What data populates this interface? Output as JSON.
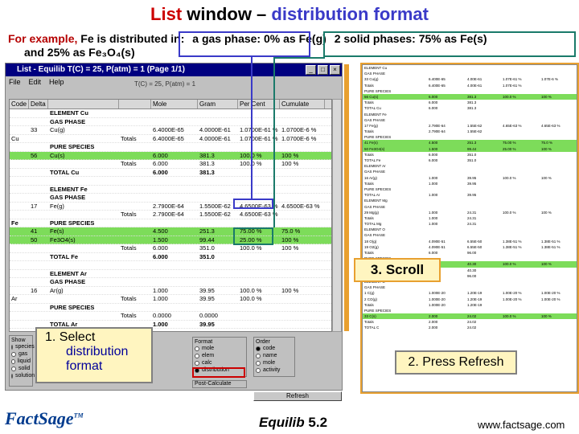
{
  "slide": {
    "title_part1": "List",
    "title_part2": "window –",
    "title_part3": "distribution format",
    "example_line1_red": "For example,",
    "example_line1_black": "Fe is distributed in:",
    "example_line1_gas": "a gas phase: 0% as Fe(g)",
    "example_line1_solid": "2 solid phases: 75% as Fe(s)",
    "example_line2": "and 25% as Fe₃O₄(s)"
  },
  "window": {
    "title": "List - Equilib T(C) = 25, P(atm) = 1 (Page 1/1)",
    "menus": [
      "File",
      "Edit",
      "Help"
    ],
    "info": "T(C) = 25, P(atm) = 1",
    "columns": [
      "Code",
      "Delta",
      "Mole",
      "Gram",
      "Per Cent",
      "Cumulate"
    ],
    "rows": [
      {
        "c1": "",
        "c2": "",
        "c3": "ELEMENT Cu",
        "c4": "",
        "c5": "",
        "c6": "",
        "c7": "",
        "c8": "",
        "style": "bold"
      },
      {
        "c1": "",
        "c2": "",
        "c3": "GAS PHASE",
        "c4": "",
        "c5": "",
        "c6": "",
        "c7": "",
        "c8": "",
        "style": "bold"
      },
      {
        "c1": "",
        "c2": "33",
        "c3": "Cu(g)",
        "c4": "",
        "c5": "6.4000E-65",
        "c6": "4.0000E-61",
        "c7": "1.0700E-61 %",
        "c8": "1.0700E-6 %",
        "style": ""
      },
      {
        "c1": "Cu",
        "c2": "",
        "c3": "",
        "c4": "Totals",
        "c5": "6.4000E-65",
        "c6": "4.0000E-61",
        "c7": "1.0700E-61 %",
        "c8": "1.0700E-6 %",
        "style": ""
      },
      {
        "c1": "",
        "c2": "",
        "c3": "PURE SPECIES",
        "c4": "",
        "c5": "",
        "c6": "",
        "c7": "",
        "c8": "",
        "style": "bold"
      },
      {
        "c1": "",
        "c2": "56",
        "c3": "Cu(s)",
        "c4": "",
        "c5": "6.000",
        "c6": "381.3",
        "c7": "100.0 %",
        "c8": "100 %",
        "style": "green"
      },
      {
        "c1": "",
        "c2": "",
        "c3": "",
        "c4": "Totals",
        "c5": "6.000",
        "c6": "381.3",
        "c7": "100.0 %",
        "c8": "100 %",
        "style": ""
      },
      {
        "c1": "",
        "c2": "",
        "c3": "TOTAL Cu",
        "c4": "",
        "c5": "6.000",
        "c6": "381.3",
        "c7": "",
        "c8": "",
        "style": "bold"
      },
      {
        "c1": "",
        "c2": "",
        "c3": "",
        "c4": "",
        "c5": "",
        "c6": "",
        "c7": "",
        "c8": "",
        "style": ""
      },
      {
        "c1": "",
        "c2": "",
        "c3": "ELEMENT Fe",
        "c4": "",
        "c5": "",
        "c6": "",
        "c7": "",
        "c8": "",
        "style": "bold"
      },
      {
        "c1": "",
        "c2": "",
        "c3": "GAS PHASE",
        "c4": "",
        "c5": "",
        "c6": "",
        "c7": "",
        "c8": "",
        "style": "bold"
      },
      {
        "c1": "",
        "c2": "17",
        "c3": "Fe(g)",
        "c4": "",
        "c5": "2.7900E-64",
        "c6": "1.5500E-62",
        "c7": "4.6500E-63 %",
        "c8": "4.6500E-63 %",
        "style": ""
      },
      {
        "c1": "",
        "c2": "",
        "c3": "",
        "c4": "Totals",
        "c5": "2.7900E-64",
        "c6": "1.5500E-62",
        "c7": "4.6500E-63 %",
        "c8": "",
        "style": ""
      },
      {
        "c1": "Fe",
        "c2": "",
        "c3": "PURE SPECIES",
        "c4": "",
        "c5": "",
        "c6": "",
        "c7": "",
        "c8": "",
        "style": "bold"
      },
      {
        "c1": "",
        "c2": "41",
        "c3": "Fe(s)",
        "c4": "",
        "c5": "4.500",
        "c6": "251.3",
        "c7": "75.00 %",
        "c8": "75.0 %",
        "style": "green"
      },
      {
        "c1": "",
        "c2": "50",
        "c3": "Fe3O4(s)",
        "c4": "",
        "c5": "1.500",
        "c6": "99.44",
        "c7": "25.00 %",
        "c8": "100 %",
        "style": "green"
      },
      {
        "c1": "",
        "c2": "",
        "c3": "",
        "c4": "Totals",
        "c5": "6.000",
        "c6": "351.0",
        "c7": "100.0 %",
        "c8": "100 %",
        "style": ""
      },
      {
        "c1": "",
        "c2": "",
        "c3": "TOTAL Fe",
        "c4": "",
        "c5": "6.000",
        "c6": "351.0",
        "c7": "",
        "c8": "",
        "style": "bold"
      },
      {
        "c1": "",
        "c2": "",
        "c3": "",
        "c4": "",
        "c5": "",
        "c6": "",
        "c7": "",
        "c8": "",
        "style": ""
      },
      {
        "c1": "",
        "c2": "",
        "c3": "ELEMENT Ar",
        "c4": "",
        "c5": "",
        "c6": "",
        "c7": "",
        "c8": "",
        "style": "bold"
      },
      {
        "c1": "",
        "c2": "",
        "c3": "GAS PHASE",
        "c4": "",
        "c5": "",
        "c6": "",
        "c7": "",
        "c8": "",
        "style": "bold"
      },
      {
        "c1": "",
        "c2": "16",
        "c3": "Ar(g)",
        "c4": "",
        "c5": "1.000",
        "c6": "39.95",
        "c7": "100.0 %",
        "c8": "100 %",
        "style": ""
      },
      {
        "c1": "Ar",
        "c2": "",
        "c3": "",
        "c4": "Totals",
        "c5": "1.000",
        "c6": "39.95",
        "c7": "100.0 %",
        "c8": "",
        "style": ""
      },
      {
        "c1": "",
        "c2": "",
        "c3": "PURE SPECIES",
        "c4": "",
        "c5": "",
        "c6": "",
        "c7": "",
        "c8": "",
        "style": "bold"
      },
      {
        "c1": "",
        "c2": "",
        "c3": "",
        "c4": "Totals",
        "c5": "0.0000",
        "c6": "0.0000",
        "c7": "",
        "c8": "",
        "style": ""
      },
      {
        "c1": "",
        "c2": "",
        "c3": "TOTAL Ar",
        "c4": "",
        "c5": "1.000",
        "c6": "39.95",
        "c7": "",
        "c8": "",
        "style": "bold"
      }
    ],
    "show_label": "Show",
    "show_items": [
      "species",
      "gas",
      "liquid",
      "solid",
      "solution"
    ],
    "format_label": "Format",
    "format_items": [
      "mole",
      "elem",
      "calc",
      "distribution"
    ],
    "format_selected": 3,
    "order_label": "Order",
    "order_items": [
      "code",
      "name",
      "mole",
      "activity"
    ],
    "post_label": "Post-Calculate",
    "post_item": "activity",
    "refresh_label": "Refresh"
  },
  "right_panel": {
    "rows": [
      {
        "a": "ELEMENT Cu",
        "b": "",
        "c": "",
        "d": "",
        "e": "",
        "style": ""
      },
      {
        "a": "GAS PHASE",
        "b": "",
        "c": "",
        "d": "",
        "e": "",
        "style": ""
      },
      {
        "a": "33  Cu(g)",
        "b": "6.400E-65",
        "c": "4.00E-61",
        "d": "1.07E-61 %",
        "e": "1.07E-6 %",
        "style": ""
      },
      {
        "a": "Totals",
        "b": "6.400E-65",
        "c": "4.00E-61",
        "d": "1.07E-61 %",
        "e": "",
        "style": ""
      },
      {
        "a": "PURE SPECIES",
        "b": "",
        "c": "",
        "d": "",
        "e": "",
        "style": ""
      },
      {
        "a": "56  Cu(s)",
        "b": "6.000",
        "c": "381.3",
        "d": "100.0 %",
        "e": "100 %",
        "style": "green"
      },
      {
        "a": "Totals",
        "b": "6.000",
        "c": "381.3",
        "d": "",
        "e": "",
        "style": ""
      },
      {
        "a": "TOTAL Cu",
        "b": "6.000",
        "c": "381.3",
        "d": "",
        "e": "",
        "style": ""
      },
      {
        "a": "ELEMENT Fe",
        "b": "",
        "c": "",
        "d": "",
        "e": "",
        "style": ""
      },
      {
        "a": "GAS PHASE",
        "b": "",
        "c": "",
        "d": "",
        "e": "",
        "style": ""
      },
      {
        "a": "17  Fe(g)",
        "b": "2.790E-64",
        "c": "1.55E-62",
        "d": "4.65E-63 %",
        "e": "4.65E-63 %",
        "style": ""
      },
      {
        "a": "Totals",
        "b": "2.790E-64",
        "c": "1.55E-62",
        "d": "",
        "e": "",
        "style": ""
      },
      {
        "a": "PURE SPECIES",
        "b": "",
        "c": "",
        "d": "",
        "e": "",
        "style": ""
      },
      {
        "a": "41  Fe(s)",
        "b": "4.500",
        "c": "251.3",
        "d": "75.00 %",
        "e": "75.0 %",
        "style": "green"
      },
      {
        "a": "50  Fe3O4(s)",
        "b": "1.500",
        "c": "99.44",
        "d": "25.00 %",
        "e": "100 %",
        "style": "green"
      },
      {
        "a": "Totals",
        "b": "6.000",
        "c": "351.0",
        "d": "",
        "e": "",
        "style": ""
      },
      {
        "a": "TOTAL Fe",
        "b": "6.000",
        "c": "351.0",
        "d": "",
        "e": "",
        "style": ""
      },
      {
        "a": "ELEMENT Ar",
        "b": "",
        "c": "",
        "d": "",
        "e": "",
        "style": ""
      },
      {
        "a": "GAS PHASE",
        "b": "",
        "c": "",
        "d": "",
        "e": "",
        "style": ""
      },
      {
        "a": "16  Ar(g)",
        "b": "1.000",
        "c": "39.95",
        "d": "100.0 %",
        "e": "100 %",
        "style": ""
      },
      {
        "a": "Totals",
        "b": "1.000",
        "c": "39.95",
        "d": "",
        "e": "",
        "style": ""
      },
      {
        "a": "PURE SPECIES",
        "b": "",
        "c": "",
        "d": "",
        "e": "",
        "style": ""
      },
      {
        "a": "TOTAL Ar",
        "b": "1.000",
        "c": "39.95",
        "d": "",
        "e": "",
        "style": ""
      },
      {
        "a": "ELEMENT Mg",
        "b": "",
        "c": "",
        "d": "",
        "e": "",
        "style": ""
      },
      {
        "a": "GAS PHASE",
        "b": "",
        "c": "",
        "d": "",
        "e": "",
        "style": ""
      },
      {
        "a": "29  Mg(g)",
        "b": "1.000",
        "c": "24.31",
        "d": "100.0 %",
        "e": "100 %",
        "style": ""
      },
      {
        "a": "Totals",
        "b": "1.000",
        "c": "24.31",
        "d": "",
        "e": "",
        "style": ""
      },
      {
        "a": "TOTAL Mg",
        "b": "1.000",
        "c": "24.31",
        "d": "",
        "e": "",
        "style": ""
      },
      {
        "a": "ELEMENT O",
        "b": "",
        "c": "",
        "d": "",
        "e": "",
        "style": ""
      },
      {
        "a": "GAS PHASE",
        "b": "",
        "c": "",
        "d": "",
        "e": "",
        "style": ""
      },
      {
        "a": "18  O(g)",
        "b": "4.090E-51",
        "c": "6.55E-50",
        "d": "1.38E-51 %",
        "e": "1.38E-51 %",
        "style": ""
      },
      {
        "a": "19  O2(g)",
        "b": "4.090E-51",
        "c": "6.55E-50",
        "d": "1.38E-51 %",
        "e": "1.38E-51 %",
        "style": ""
      },
      {
        "a": "Totals",
        "b": "6.000",
        "c": "96.00",
        "d": "",
        "e": "",
        "style": ""
      },
      {
        "a": "PURE SPECIES",
        "b": "",
        "c": "",
        "d": "",
        "e": "",
        "style": ""
      },
      {
        "a": "57  MgO(s)",
        "b": "1.000",
        "c": "40.30",
        "d": "100.0 %",
        "e": "100 %",
        "style": "green"
      },
      {
        "a": "Totals",
        "b": "1.000",
        "c": "40.30",
        "d": "",
        "e": "",
        "style": ""
      },
      {
        "a": "TOTAL O",
        "b": "6.000",
        "c": "96.00",
        "d": "",
        "e": "",
        "style": ""
      },
      {
        "a": "ELEMENT C",
        "b": "",
        "c": "",
        "d": "",
        "e": "",
        "style": ""
      },
      {
        "a": "GAS PHASE",
        "b": "",
        "c": "",
        "d": "",
        "e": "",
        "style": ""
      },
      {
        "a": "1  C(g)",
        "b": "1.000E-20",
        "c": "1.20E-19",
        "d": "1.00E-20 %",
        "e": "1.00E-20 %",
        "style": ""
      },
      {
        "a": "2  CO(g)",
        "b": "1.000E-20",
        "c": "1.20E-19",
        "d": "1.00E-20 %",
        "e": "1.00E-20 %",
        "style": ""
      },
      {
        "a": "Totals",
        "b": "1.000E-20",
        "c": "1.20E-19",
        "d": "",
        "e": "",
        "style": ""
      },
      {
        "a": "PURE SPECIES",
        "b": "",
        "c": "",
        "d": "",
        "e": "",
        "style": ""
      },
      {
        "a": "33  C(s)",
        "b": "2.000",
        "c": "24.02",
        "d": "100.0 %",
        "e": "100 %",
        "style": "green"
      },
      {
        "a": "Totals",
        "b": "2.000",
        "c": "24.02",
        "d": "",
        "e": "",
        "style": ""
      },
      {
        "a": "TOTAL C",
        "b": "2.000",
        "c": "24.02",
        "d": "",
        "e": "",
        "style": ""
      }
    ]
  },
  "callouts": {
    "scroll": "3.  Scroll",
    "select_line1": "1.  Select",
    "select_line2": "distribution",
    "select_line3": "format",
    "refresh": "2.  Press Refresh"
  },
  "footer": {
    "logo": "FactSage",
    "logo_tm": "TM",
    "center": "Equilib",
    "version": "5.2",
    "url": "www.factsage.com"
  },
  "colors": {
    "title_red": "#cc0000",
    "title_blue": "#3a3ac8",
    "highlight_green": "#7ddc5a",
    "callout_fill": "#fff5c0",
    "scroll_orange": "#e8a030",
    "window_title": "#000080"
  }
}
